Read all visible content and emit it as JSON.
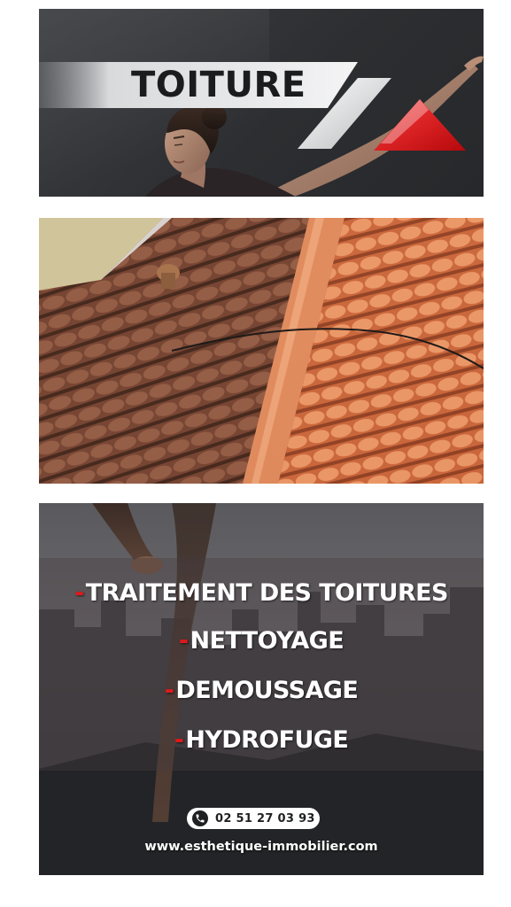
{
  "header": {
    "title": "TOITURE"
  },
  "services": [
    "TRAITEMENT DES TOITURES",
    "NETTOYAGE",
    "DEMOUSSAGE",
    "HYDROFUGE"
  ],
  "bullet": "-",
  "contact": {
    "phone": "02 51 27 03 93",
    "website": "www.esthetique-immobilier.com"
  },
  "colors": {
    "accent_red": "#e0191b",
    "dark_background": "#2f3134",
    "text_white": "#ffffff"
  },
  "icons": {
    "phone": "phone-icon",
    "logo": "roof-triangle-logo"
  }
}
